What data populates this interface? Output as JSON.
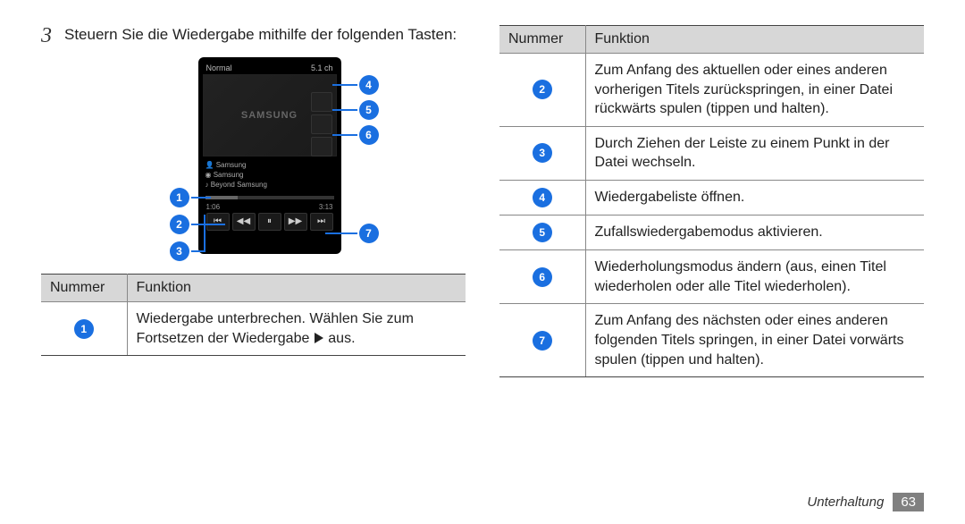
{
  "step": {
    "num": "3",
    "text": "Steuern Sie die Wiedergabe mithilfe der folgenden Tasten:"
  },
  "phone": {
    "topLeft": "Normal",
    "topRight": "5.1 ch",
    "albumText": "SAMSUNG",
    "meta1": "Samsung",
    "meta2": "Samsung",
    "meta3": "Beyond Samsung",
    "timeLeft": "1:06",
    "timeRight": "3:13"
  },
  "callouts": {
    "1": "1",
    "2": "2",
    "3": "3",
    "4": "4",
    "5": "5",
    "6": "6",
    "7": "7"
  },
  "tableLeft": {
    "headNum": "Nummer",
    "headFunc": "Funktion",
    "rows": [
      {
        "n": "1",
        "text_a": "Wiedergabe unterbrechen. Wählen Sie zum Fortsetzen der Wiedergabe ",
        "text_b": " aus."
      }
    ]
  },
  "tableRight": {
    "headNum": "Nummer",
    "headFunc": "Funktion",
    "rows": [
      {
        "n": "2",
        "text": "Zum Anfang des aktuellen oder eines anderen vorherigen Titels zurückspringen, in einer Datei rückwärts spulen (tippen und halten)."
      },
      {
        "n": "3",
        "text": "Durch Ziehen der Leiste zu einem Punkt in der Datei wechseln."
      },
      {
        "n": "4",
        "text": "Wiedergabeliste öffnen."
      },
      {
        "n": "5",
        "text": "Zufallswiedergabemodus aktivieren."
      },
      {
        "n": "6",
        "text": "Wiederholungsmodus ändern (aus, einen Titel wiederholen oder alle Titel wiederholen)."
      },
      {
        "n": "7",
        "text": "Zum Anfang des nächsten oder eines anderen folgenden Titels springen, in einer Datei vorwärts spulen (tippen und halten)."
      }
    ]
  },
  "footer": {
    "section": "Unterhaltung",
    "page": "63"
  }
}
